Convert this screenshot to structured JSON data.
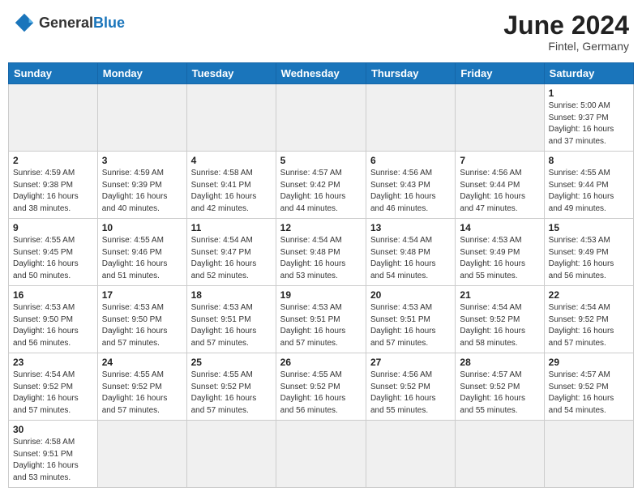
{
  "header": {
    "logo_general": "General",
    "logo_blue": "Blue",
    "month_year": "June 2024",
    "location": "Fintel, Germany"
  },
  "weekdays": [
    "Sunday",
    "Monday",
    "Tuesday",
    "Wednesday",
    "Thursday",
    "Friday",
    "Saturday"
  ],
  "days": [
    {
      "num": "",
      "info": "",
      "empty": true
    },
    {
      "num": "",
      "info": "",
      "empty": true
    },
    {
      "num": "",
      "info": "",
      "empty": true
    },
    {
      "num": "",
      "info": "",
      "empty": true
    },
    {
      "num": "",
      "info": "",
      "empty": true
    },
    {
      "num": "",
      "info": "",
      "empty": true
    },
    {
      "num": "1",
      "info": "Sunrise: 5:00 AM\nSunset: 9:37 PM\nDaylight: 16 hours\nand 37 minutes."
    },
    {
      "num": "2",
      "info": "Sunrise: 4:59 AM\nSunset: 9:38 PM\nDaylight: 16 hours\nand 38 minutes."
    },
    {
      "num": "3",
      "info": "Sunrise: 4:59 AM\nSunset: 9:39 PM\nDaylight: 16 hours\nand 40 minutes."
    },
    {
      "num": "4",
      "info": "Sunrise: 4:58 AM\nSunset: 9:41 PM\nDaylight: 16 hours\nand 42 minutes."
    },
    {
      "num": "5",
      "info": "Sunrise: 4:57 AM\nSunset: 9:42 PM\nDaylight: 16 hours\nand 44 minutes."
    },
    {
      "num": "6",
      "info": "Sunrise: 4:56 AM\nSunset: 9:43 PM\nDaylight: 16 hours\nand 46 minutes."
    },
    {
      "num": "7",
      "info": "Sunrise: 4:56 AM\nSunset: 9:44 PM\nDaylight: 16 hours\nand 47 minutes."
    },
    {
      "num": "8",
      "info": "Sunrise: 4:55 AM\nSunset: 9:44 PM\nDaylight: 16 hours\nand 49 minutes."
    },
    {
      "num": "9",
      "info": "Sunrise: 4:55 AM\nSunset: 9:45 PM\nDaylight: 16 hours\nand 50 minutes."
    },
    {
      "num": "10",
      "info": "Sunrise: 4:55 AM\nSunset: 9:46 PM\nDaylight: 16 hours\nand 51 minutes."
    },
    {
      "num": "11",
      "info": "Sunrise: 4:54 AM\nSunset: 9:47 PM\nDaylight: 16 hours\nand 52 minutes."
    },
    {
      "num": "12",
      "info": "Sunrise: 4:54 AM\nSunset: 9:48 PM\nDaylight: 16 hours\nand 53 minutes."
    },
    {
      "num": "13",
      "info": "Sunrise: 4:54 AM\nSunset: 9:48 PM\nDaylight: 16 hours\nand 54 minutes."
    },
    {
      "num": "14",
      "info": "Sunrise: 4:53 AM\nSunset: 9:49 PM\nDaylight: 16 hours\nand 55 minutes."
    },
    {
      "num": "15",
      "info": "Sunrise: 4:53 AM\nSunset: 9:49 PM\nDaylight: 16 hours\nand 56 minutes."
    },
    {
      "num": "16",
      "info": "Sunrise: 4:53 AM\nSunset: 9:50 PM\nDaylight: 16 hours\nand 56 minutes."
    },
    {
      "num": "17",
      "info": "Sunrise: 4:53 AM\nSunset: 9:50 PM\nDaylight: 16 hours\nand 57 minutes."
    },
    {
      "num": "18",
      "info": "Sunrise: 4:53 AM\nSunset: 9:51 PM\nDaylight: 16 hours\nand 57 minutes."
    },
    {
      "num": "19",
      "info": "Sunrise: 4:53 AM\nSunset: 9:51 PM\nDaylight: 16 hours\nand 57 minutes."
    },
    {
      "num": "20",
      "info": "Sunrise: 4:53 AM\nSunset: 9:51 PM\nDaylight: 16 hours\nand 57 minutes."
    },
    {
      "num": "21",
      "info": "Sunrise: 4:54 AM\nSunset: 9:52 PM\nDaylight: 16 hours\nand 58 minutes."
    },
    {
      "num": "22",
      "info": "Sunrise: 4:54 AM\nSunset: 9:52 PM\nDaylight: 16 hours\nand 57 minutes."
    },
    {
      "num": "23",
      "info": "Sunrise: 4:54 AM\nSunset: 9:52 PM\nDaylight: 16 hours\nand 57 minutes."
    },
    {
      "num": "24",
      "info": "Sunrise: 4:55 AM\nSunset: 9:52 PM\nDaylight: 16 hours\nand 57 minutes."
    },
    {
      "num": "25",
      "info": "Sunrise: 4:55 AM\nSunset: 9:52 PM\nDaylight: 16 hours\nand 57 minutes."
    },
    {
      "num": "26",
      "info": "Sunrise: 4:55 AM\nSunset: 9:52 PM\nDaylight: 16 hours\nand 56 minutes."
    },
    {
      "num": "27",
      "info": "Sunrise: 4:56 AM\nSunset: 9:52 PM\nDaylight: 16 hours\nand 55 minutes."
    },
    {
      "num": "28",
      "info": "Sunrise: 4:57 AM\nSunset: 9:52 PM\nDaylight: 16 hours\nand 55 minutes."
    },
    {
      "num": "29",
      "info": "Sunrise: 4:57 AM\nSunset: 9:52 PM\nDaylight: 16 hours\nand 54 minutes."
    },
    {
      "num": "30",
      "info": "Sunrise: 4:58 AM\nSunset: 9:51 PM\nDaylight: 16 hours\nand 53 minutes."
    },
    {
      "num": "",
      "info": "",
      "empty": true
    },
    {
      "num": "",
      "info": "",
      "empty": true
    },
    {
      "num": "",
      "info": "",
      "empty": true
    },
    {
      "num": "",
      "info": "",
      "empty": true
    },
    {
      "num": "",
      "info": "",
      "empty": true
    },
    {
      "num": "",
      "info": "",
      "empty": true
    }
  ]
}
